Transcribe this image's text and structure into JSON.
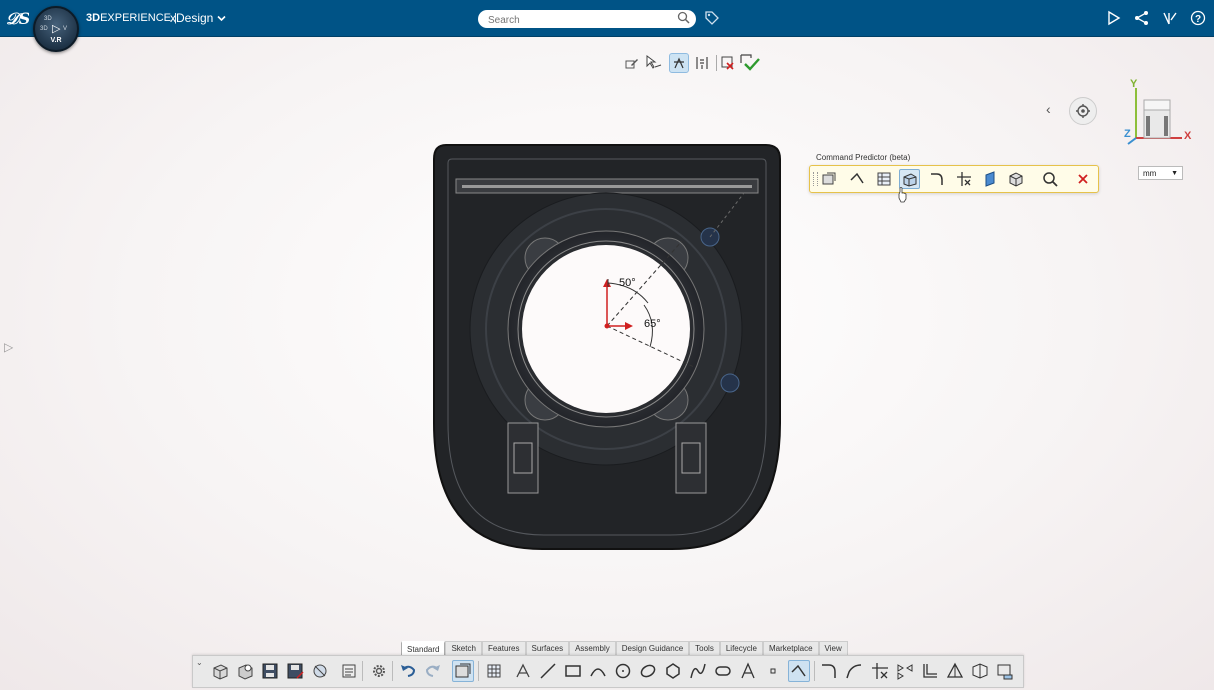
{
  "app": {
    "brand_bold": "3D",
    "brand_rest": "EXPERIENCE |",
    "app_name": "xDesign",
    "compass_version": "V.R"
  },
  "search": {
    "placeholder": "Search"
  },
  "command_predictor": {
    "title": "Command Predictor (beta)"
  },
  "units": {
    "selected": "mm"
  },
  "triad": {
    "y_label": "Y",
    "x_label": "X",
    "z_label": "Z"
  },
  "dimensions": {
    "angle1": "50°",
    "angle2": "65°"
  },
  "tabs": [
    {
      "label": "Standard",
      "active": true
    },
    {
      "label": "Sketch",
      "active": false
    },
    {
      "label": "Features",
      "active": false
    },
    {
      "label": "Surfaces",
      "active": false
    },
    {
      "label": "Assembly",
      "active": false
    },
    {
      "label": "Design Guidance",
      "active": false
    },
    {
      "label": "Tools",
      "active": false
    },
    {
      "label": "Lifecycle",
      "active": false
    },
    {
      "label": "Marketplace",
      "active": false
    },
    {
      "label": "View",
      "active": false
    }
  ],
  "colors": {
    "topbar": "#005386",
    "accent_red": "#d02020",
    "part_body": "#2b2d30"
  }
}
